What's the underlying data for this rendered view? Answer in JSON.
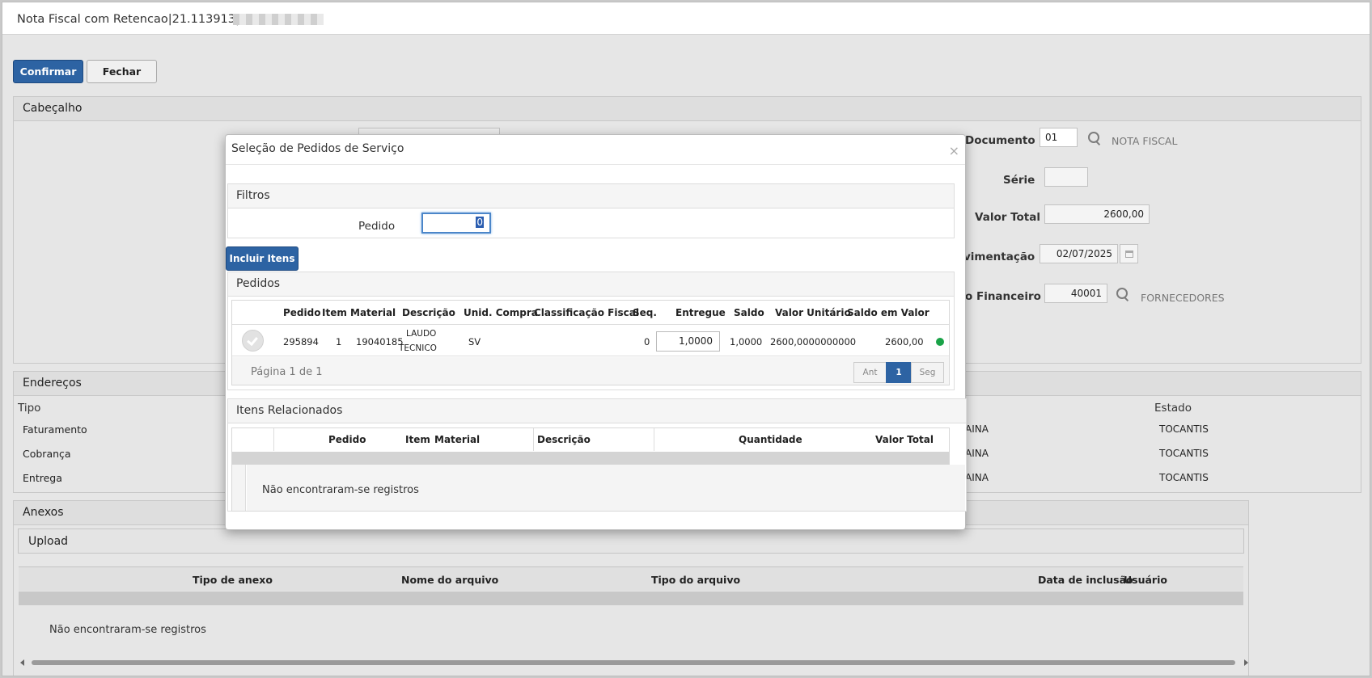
{
  "window": {
    "title": "Nota Fiscal com Retencao|21.113913|"
  },
  "toolbar": {
    "confirm_label": "Confirmar",
    "close_label": "Fechar"
  },
  "header_panel": {
    "title": "Cabeçalho",
    "doc_label": "Documento",
    "doc_value": "01",
    "doc_desc": "NOTA FISCAL",
    "serie_label": "Série",
    "serie_value": "",
    "total_label": "Valor Total",
    "total_value": "2600,00",
    "mov_label": "vimentação",
    "mov_value": "02/07/2025",
    "fin_label": "o Financeiro",
    "fin_value": "40001",
    "fin_desc": "FORNECEDORES"
  },
  "addresses": {
    "title": "Endereços",
    "col_tipo": "Tipo",
    "col_estado": "Estado",
    "rows": [
      {
        "tipo": "Faturamento",
        "city": "AINA",
        "estado": "TOCANTIS"
      },
      {
        "tipo": "Cobrança",
        "city": "AINA",
        "estado": "TOCANTIS"
      },
      {
        "tipo": "Entrega",
        "city": "AINA",
        "estado": "TOCANTIS"
      }
    ]
  },
  "attachments": {
    "title": "Anexos",
    "upload_label": "Upload",
    "columns": [
      "Tipo de anexo",
      "Nome do arquivo",
      "Tipo do arquivo",
      "Data de inclusão",
      "Usuário"
    ],
    "empty": "Não encontraram-se registros"
  },
  "modal": {
    "title": "Seleção de Pedidos de Serviço",
    "close": "×",
    "filters_title": "Filtros",
    "pedido_label": "Pedido",
    "pedido_value": "0",
    "include_button": "Incluir Itens",
    "orders": {
      "title": "Pedidos",
      "columns": [
        "Pedido",
        "Item",
        "Material",
        "Descrição",
        "Unid. Compra",
        "Classificação Fiscal",
        "Seq.",
        "Entregue",
        "Saldo",
        "Valor Unitário",
        "Saldo em Valor"
      ],
      "rows": [
        {
          "pedido": "295894",
          "item": "1",
          "material": "19040185",
          "descricao_1": "LAUDO",
          "descricao_2": "TECNICO",
          "unid": "SV",
          "classif": "",
          "seq": "0",
          "entregue": "1,0000",
          "saldo": "1,0000",
          "valor_unit": "2600,0000000000",
          "saldo_valor": "2600,00",
          "status_color": "#1aa348"
        }
      ],
      "pagination": {
        "text": "Página 1 de 1",
        "prev": "Ant",
        "current": "1",
        "next": "Seg"
      }
    },
    "related": {
      "title": "Itens Relacionados",
      "columns": [
        "Pedido",
        "Item",
        "Material",
        "Descrição",
        "Quantidade",
        "Valor Total"
      ],
      "empty": "Não encontraram-se registros"
    }
  },
  "colors": {
    "primary": "#2d63a3",
    "status_ok": "#1aa348"
  }
}
